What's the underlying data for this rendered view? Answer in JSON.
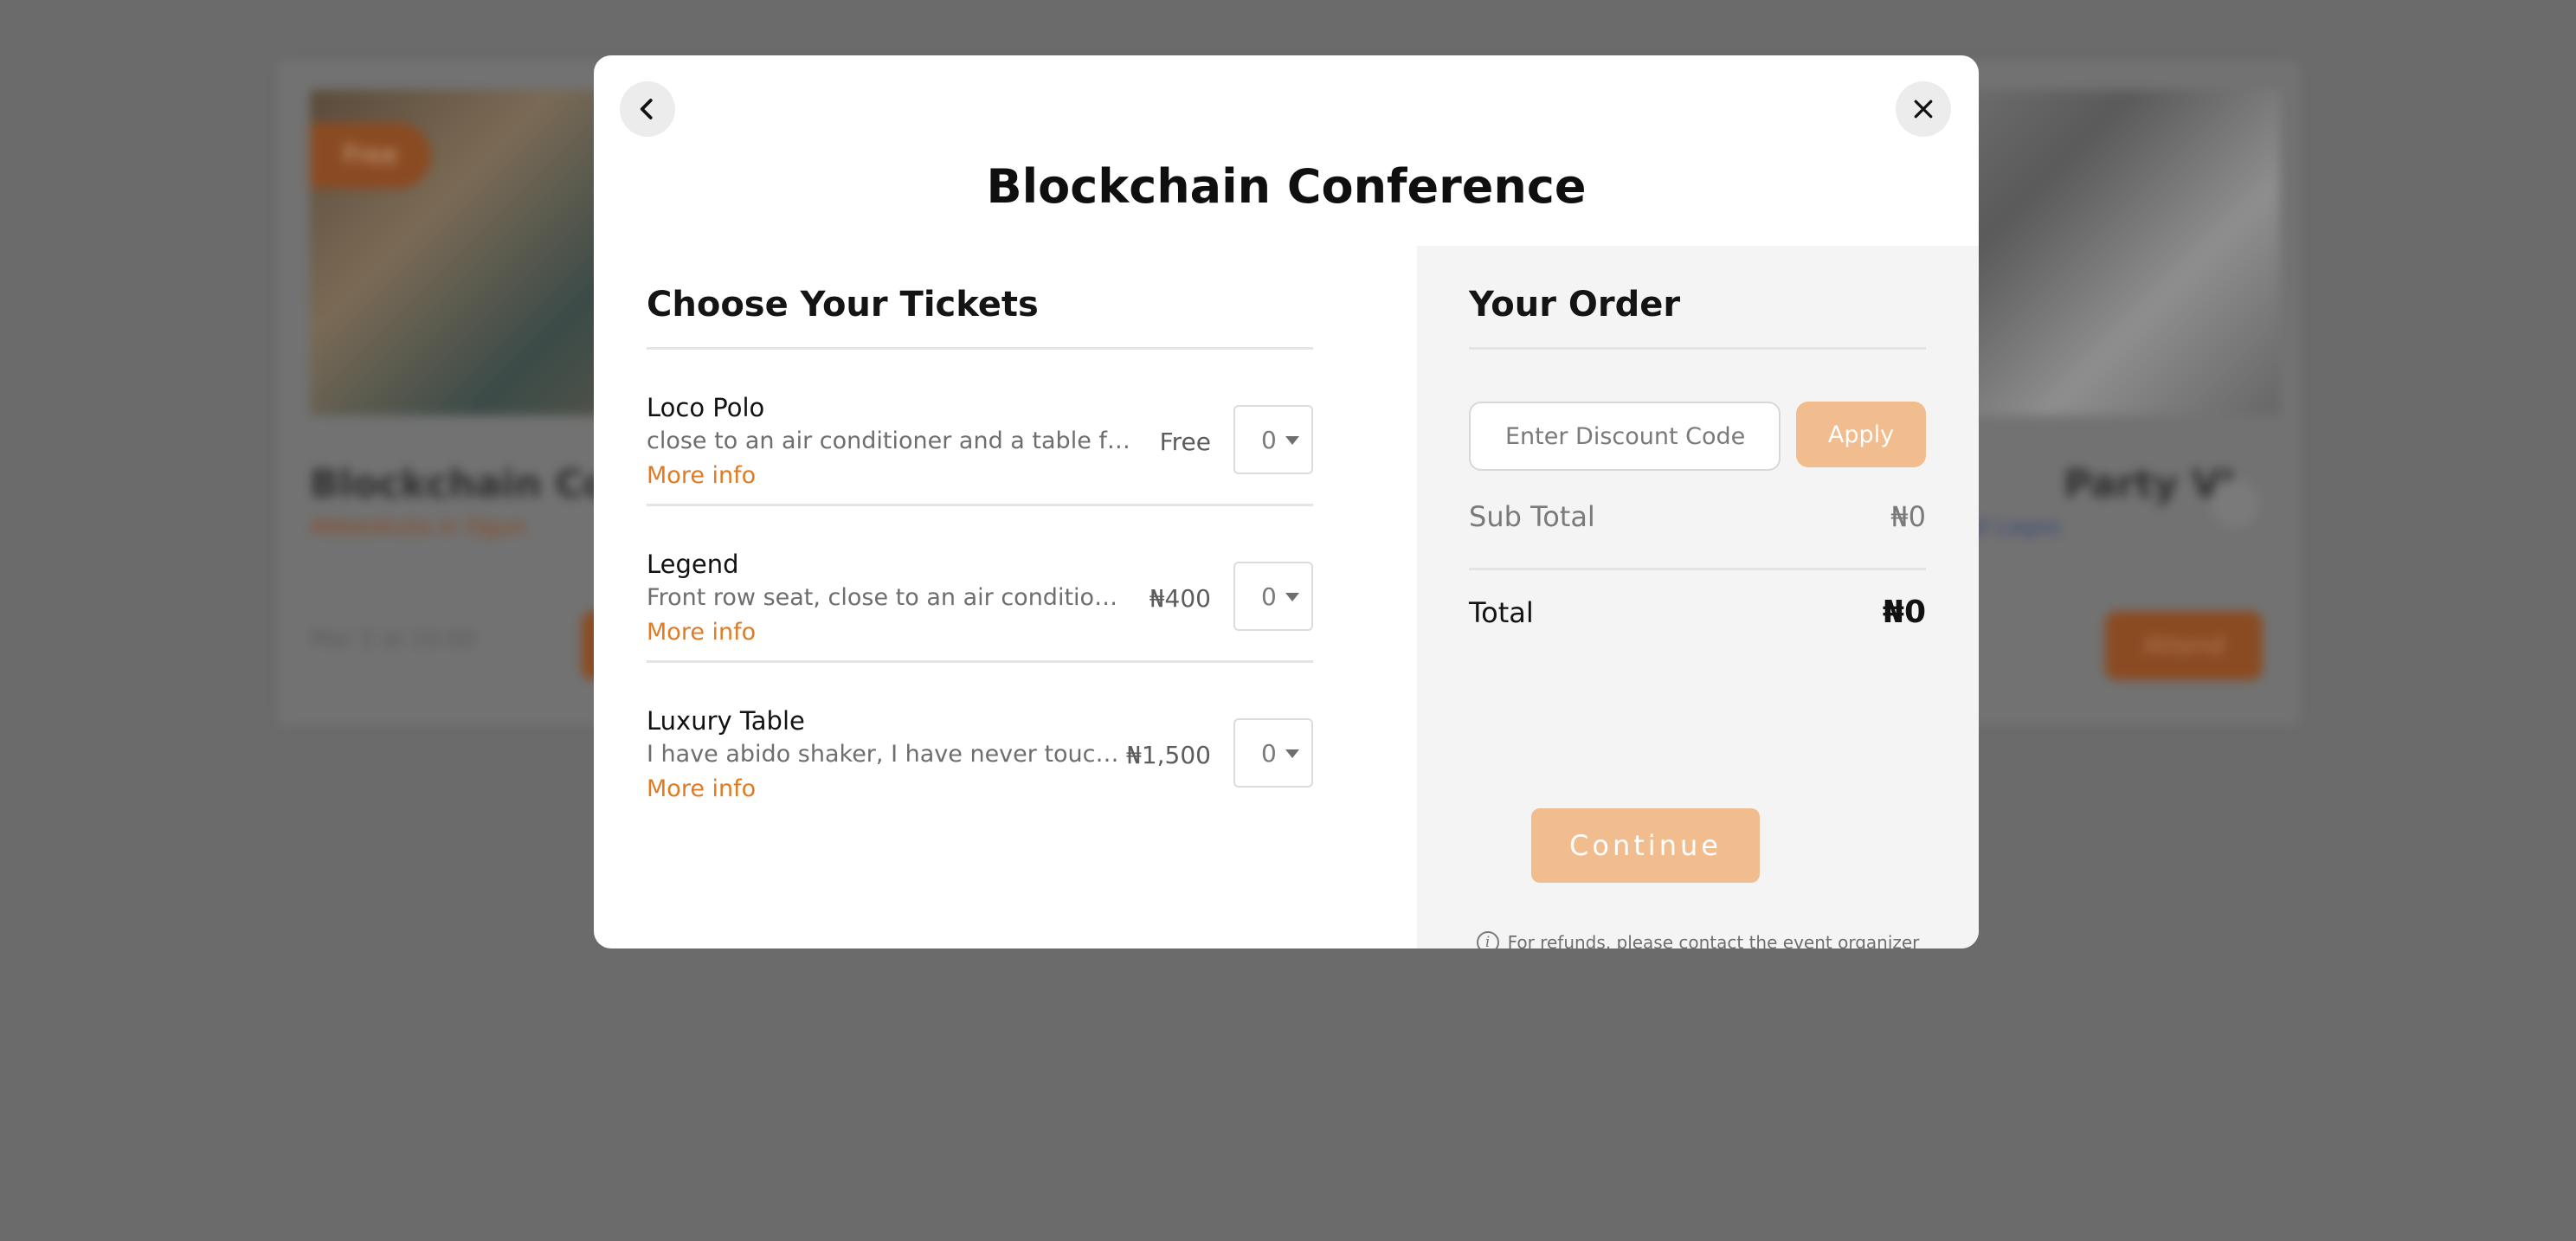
{
  "background": {
    "badge_left": "Free",
    "event_title_left": "Blockchain Confe",
    "event_sub_left": "Abbeokuta in Ogun",
    "event_date_left": "Mar 2 at 10:00",
    "event_title_right": "Party VI",
    "event_sub_right": "ad Lagos",
    "event_btn_right": "Attend"
  },
  "modal": {
    "title": "Blockchain Conference",
    "back_icon": "chevron-left-icon",
    "close_icon": "close-icon"
  },
  "tickets": {
    "heading": "Choose Your Tickets",
    "more_info_label": "More info",
    "items": [
      {
        "name": "Loco Polo",
        "description": "close to an air conditioner and a table full of drinks",
        "price": "Free",
        "quantity": "0"
      },
      {
        "name": "Legend",
        "description": "Front row seat, close to an air conditioner and a table full of drinks",
        "price": "₦400",
        "quantity": "0"
      },
      {
        "name": "Luxury Table",
        "description": "I have abido shaker, I have never touched that thing before",
        "price": "₦1,500",
        "quantity": "0"
      }
    ]
  },
  "order": {
    "heading": "Your Order",
    "discount_placeholder": "Enter Discount Code",
    "apply_label": "Apply",
    "subtotal_label": "Sub Total",
    "subtotal_value": "₦0",
    "total_label": "Total",
    "total_value": "₦0",
    "continue_label": "Continue",
    "refund_note": "For refunds, please contact the event organizer"
  },
  "colors": {
    "accent": "#e07b22",
    "button_disabled": "#f2bd8e",
    "overlay": "#6b6b6b"
  }
}
